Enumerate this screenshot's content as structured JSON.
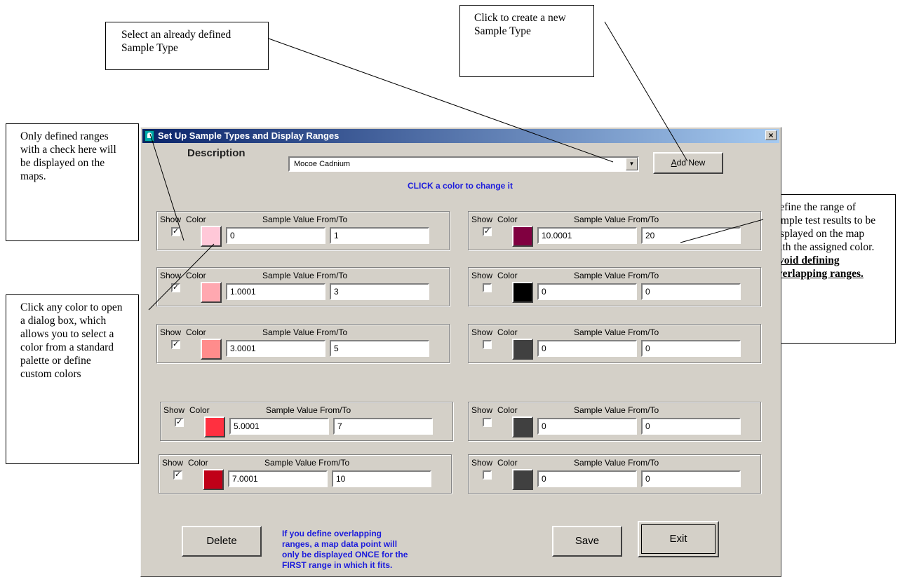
{
  "callouts": {
    "select_type": "Select an already defined Sample Type",
    "create_new": "Click to create a new Sample Type",
    "only_defined": "Only defined ranges with a check here will be displayed on the maps.",
    "click_color": "Click any color to open a dialog box, which allows you to select a color from a standard palette or define custom colors",
    "define_range": "Define the range of sample test results to be displayed on the map with the assigned color.",
    "define_range_warning": "Avoid defining overlapping ranges."
  },
  "dialog": {
    "title": "Set Up Sample Types and Display Ranges",
    "close_glyph": "×",
    "description_label": "Description",
    "description_value": "Mocoe Cadnium",
    "combo_arrow": "▼",
    "add_new_label": "Add New",
    "add_new_hotkey": "A",
    "hint": "CLICK a color to change it",
    "group_labels": {
      "show": "Show",
      "color": "Color",
      "range": "Sample Value From/To"
    },
    "ranges": [
      {
        "show": true,
        "color": "#ffc8d8",
        "from": "0",
        "to": "1"
      },
      {
        "show": true,
        "color": "#ffa8b0",
        "from": "1.0001",
        "to": "3"
      },
      {
        "show": true,
        "color": "#ff8c8c",
        "from": "3.0001",
        "to": "5"
      },
      {
        "show": true,
        "color": "#ff3040",
        "from": "5.0001",
        "to": "7"
      },
      {
        "show": true,
        "color": "#c00018",
        "from": "7.0001",
        "to": "10"
      },
      {
        "show": true,
        "color": "#800040",
        "from": "10.0001",
        "to": "20"
      },
      {
        "show": false,
        "color": "#000000",
        "from": "0",
        "to": "0"
      },
      {
        "show": false,
        "color": "#404040",
        "from": "0",
        "to": "0"
      },
      {
        "show": false,
        "color": "#404040",
        "from": "0",
        "to": "0"
      },
      {
        "show": false,
        "color": "#404040",
        "from": "0",
        "to": "0"
      }
    ],
    "buttons": {
      "delete": "Delete",
      "save": "Save",
      "exit": "Exit"
    },
    "warning": "If you define overlapping ranges, a map data point will only be displayed ONCE for the FIRST range in which it fits."
  }
}
